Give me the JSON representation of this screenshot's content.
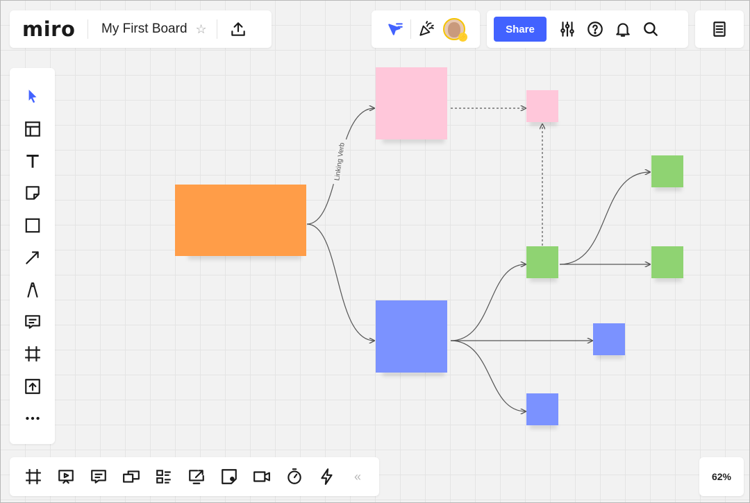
{
  "app": {
    "logo": "miro",
    "board_title": "My First Board"
  },
  "header": {
    "share_label": "Share"
  },
  "canvas": {
    "connector_label": "Linking Verb",
    "colors": {
      "orange": "#ff9d48",
      "pink": "#ffc7da",
      "blue": "#7b92ff",
      "green": "#8fd372",
      "accent": "#4262ff"
    }
  },
  "left_toolbar": {
    "tools": [
      "select-icon",
      "templates-icon",
      "text-icon",
      "sticky-note-icon",
      "shape-icon",
      "connection-line-icon",
      "pen-icon",
      "comment-icon",
      "frame-icon",
      "upload-icon",
      "more-icon"
    ]
  },
  "bottom_toolbar": {
    "tools": [
      "frames-icon",
      "presentation-icon",
      "comments-icon",
      "video-chat-icon",
      "card-list-icon",
      "screen-share-icon",
      "sticky-notes-icon",
      "video-icon",
      "timer-icon",
      "integrations-icon"
    ]
  },
  "zoom": {
    "level": "62%"
  }
}
